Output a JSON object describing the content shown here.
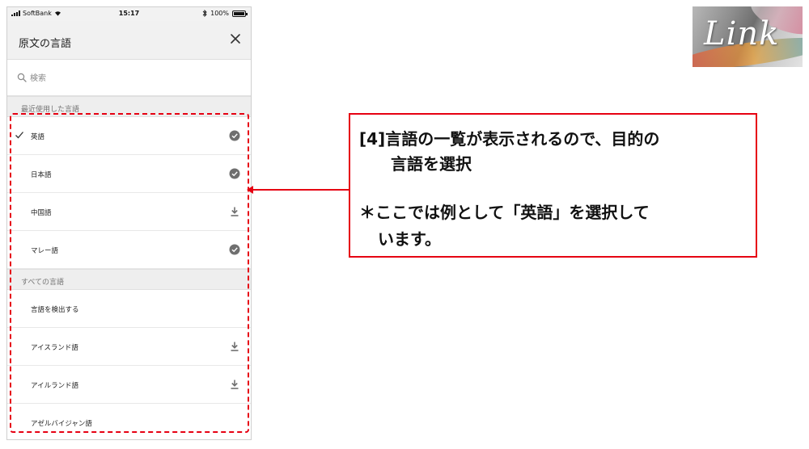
{
  "status_bar": {
    "carrier": "SoftBank",
    "time": "15:17",
    "battery": "100%"
  },
  "app_bar": {
    "title": "原文の言語"
  },
  "search": {
    "placeholder": "検索"
  },
  "recent": {
    "header": "最近使用した言語",
    "items": [
      {
        "label": "英語",
        "selected": true,
        "status_icon": "downloaded-check-icon"
      },
      {
        "label": "日本語",
        "selected": false,
        "status_icon": "downloaded-check-icon"
      },
      {
        "label": "中国語",
        "selected": false,
        "status_icon": "download-icon"
      },
      {
        "label": "マレー語",
        "selected": false,
        "status_icon": "downloaded-check-icon"
      }
    ]
  },
  "all": {
    "header": "すべての言語",
    "items": [
      {
        "label": "言語を検出する",
        "status_icon": ""
      },
      {
        "label": "アイスランド語",
        "status_icon": "download-icon"
      },
      {
        "label": "アイルランド語",
        "status_icon": "download-icon"
      },
      {
        "label": "アゼルバイジャン語",
        "status_icon": ""
      }
    ]
  },
  "callout": {
    "line1": "[4]言語の一覧が表示されるので、目的の",
    "line2": "言語を選択",
    "line3": "＊ここでは例として「英語」を選択して",
    "line4": "います。"
  },
  "logo": {
    "text": "Link"
  },
  "colors": {
    "accent": "#e60012",
    "app_bar": "#f1f1f1",
    "section": "#eeeeee"
  }
}
